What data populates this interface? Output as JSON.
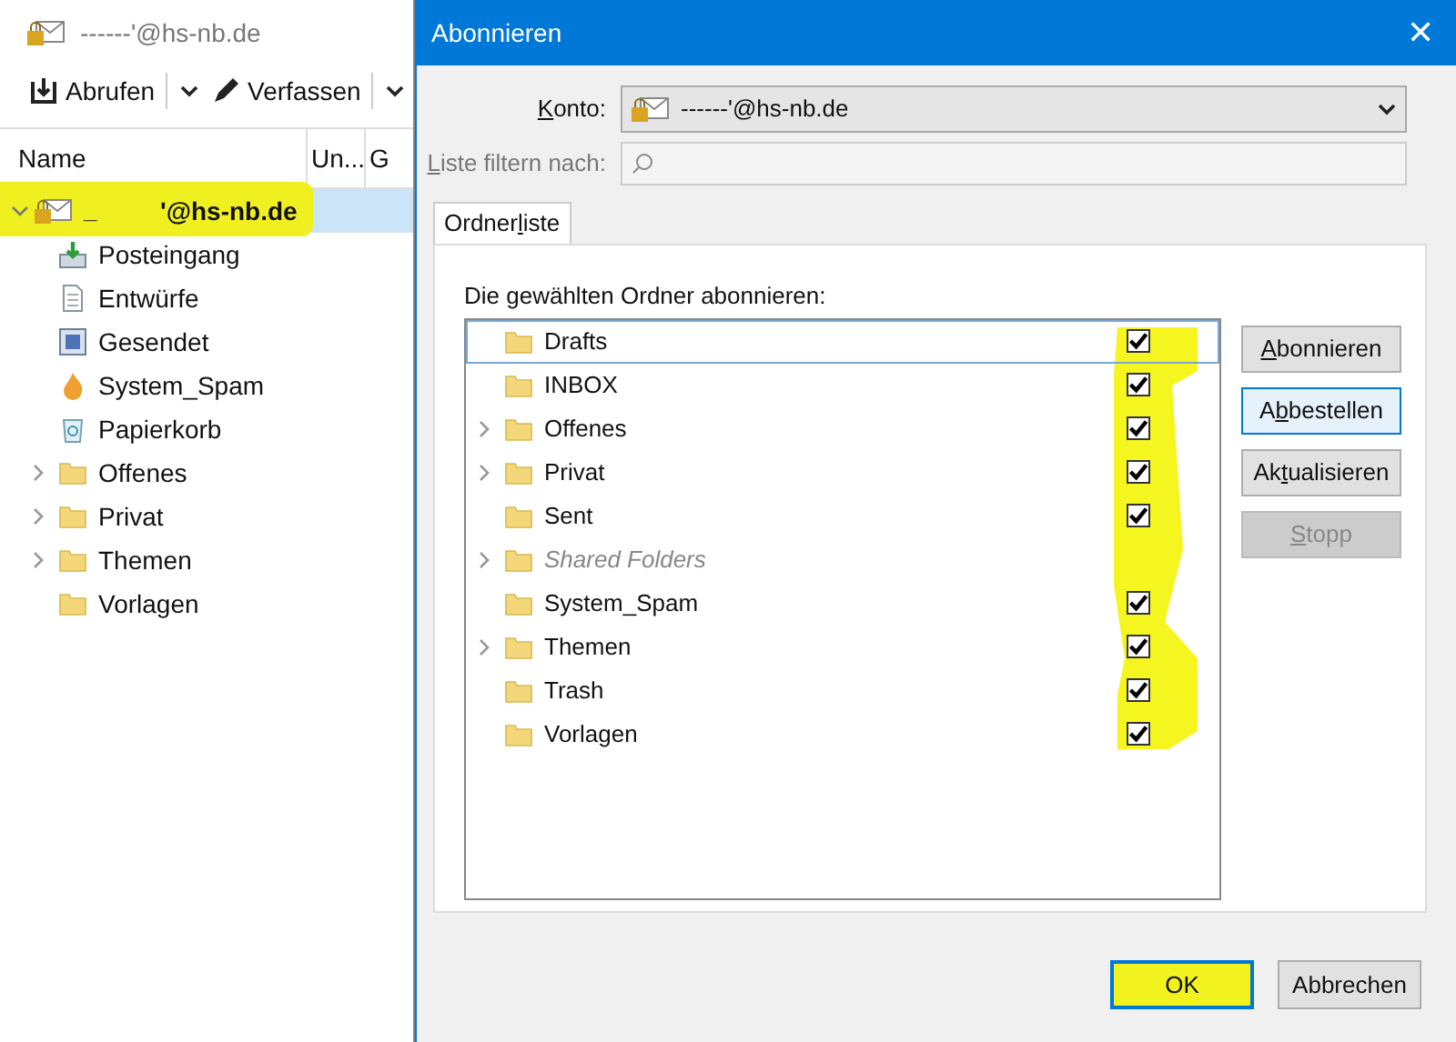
{
  "main_window": {
    "title": "------'@hs-nb.de",
    "toolbar": [
      {
        "label": "Abrufen",
        "kind": "download"
      },
      {
        "label": "Verfassen",
        "kind": "pen"
      }
    ],
    "columns": [
      "Name",
      "Un...",
      "G"
    ],
    "account": {
      "label": "'@hs-nb.de",
      "prefix": "_",
      "selected": true,
      "highlighted": true,
      "expanded": true
    },
    "folders": [
      {
        "name": "Posteingang",
        "kind": "inbox",
        "expandable": false
      },
      {
        "name": "Entwürfe",
        "kind": "drafts",
        "expandable": false
      },
      {
        "name": "Gesendet",
        "kind": "sent",
        "expandable": false
      },
      {
        "name": "System_Spam",
        "kind": "spam",
        "expandable": false
      },
      {
        "name": "Papierkorb",
        "kind": "trash",
        "expandable": false
      },
      {
        "name": "Offenes",
        "kind": "folder",
        "expandable": true
      },
      {
        "name": "Privat",
        "kind": "folder",
        "expandable": true
      },
      {
        "name": "Themen",
        "kind": "folder",
        "expandable": true
      },
      {
        "name": "Vorlagen",
        "kind": "folder",
        "expandable": false
      }
    ]
  },
  "dialog": {
    "title": "Abonnieren",
    "close": "✕",
    "account_label": {
      "key": "K",
      "after": "onto:"
    },
    "account_value": "------'@hs-nb.de",
    "filter_label": {
      "key": "L",
      "after": "iste filtern nach:"
    },
    "tabs": [
      {
        "before": "Ordner",
        "key": "l",
        "after": "iste",
        "selected": true
      }
    ],
    "list_label": "Die gewählten Ordner abonnieren:",
    "folders": [
      {
        "name": "Drafts",
        "expandable": false,
        "checked": true,
        "disabled": false,
        "focused": true
      },
      {
        "name": "INBOX",
        "expandable": false,
        "checked": true,
        "disabled": false,
        "focused": false
      },
      {
        "name": "Offenes",
        "expandable": true,
        "checked": true,
        "disabled": false,
        "focused": false
      },
      {
        "name": "Privat",
        "expandable": true,
        "checked": true,
        "disabled": false,
        "focused": false
      },
      {
        "name": "Sent",
        "expandable": false,
        "checked": true,
        "disabled": false,
        "focused": false
      },
      {
        "name": "Shared Folders",
        "expandable": true,
        "disabled": true,
        "focused": false
      },
      {
        "name": "System_Spam",
        "expandable": false,
        "checked": true,
        "disabled": false,
        "focused": false
      },
      {
        "name": "Themen",
        "expandable": true,
        "checked": true,
        "disabled": false,
        "focused": false
      },
      {
        "name": "Trash",
        "expandable": false,
        "checked": true,
        "disabled": false,
        "focused": false
      },
      {
        "name": "Vorlagen",
        "expandable": false,
        "checked": true,
        "disabled": false,
        "focused": false
      }
    ],
    "side_buttons": [
      {
        "key": "A",
        "after": "bonnieren",
        "disabled": false,
        "focused": false
      },
      {
        "before": "A",
        "key": "b",
        "after": "bestellen",
        "disabled": false,
        "focused": true
      },
      {
        "before": "Ak",
        "key": "t",
        "after": "ualisieren",
        "disabled": false,
        "focused": false
      },
      {
        "key": "S",
        "after": "topp",
        "disabled": true,
        "focused": false
      }
    ],
    "ok": {
      "label": "OK",
      "highlighted": true
    },
    "cancel": {
      "label": "Abbrechen"
    }
  }
}
